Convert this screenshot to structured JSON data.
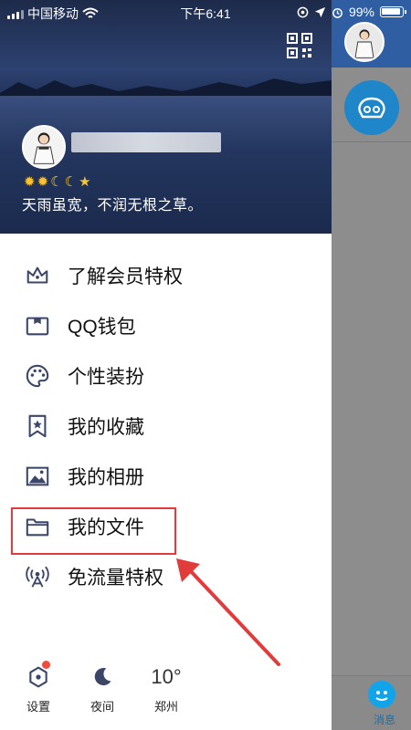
{
  "status_bar": {
    "carrier": "中国移动",
    "time": "下午6:41",
    "battery": "99%"
  },
  "header": {
    "signature": "天雨虽宽，不润无根之草。",
    "level_icons": [
      "sun-icon",
      "sun-icon",
      "moon-icon",
      "moon-icon",
      "star-icon"
    ]
  },
  "menu": [
    {
      "label": "了解会员特权",
      "icon": "crown-icon"
    },
    {
      "label": "QQ钱包",
      "icon": "wallet-icon"
    },
    {
      "label": "个性装扮",
      "icon": "palette-icon"
    },
    {
      "label": "我的收藏",
      "icon": "bookmark-star-icon"
    },
    {
      "label": "我的相册",
      "icon": "album-icon"
    },
    {
      "label": "我的文件",
      "icon": "folder-icon"
    },
    {
      "label": "免流量特权",
      "icon": "broadcast-icon"
    }
  ],
  "bottom": {
    "settings": "设置",
    "night": "夜间",
    "temperature": "10°",
    "city": "郑州"
  },
  "right_pane": {
    "messages_label": "消息"
  },
  "colors": {
    "highlight_border": "#e23b3b",
    "badge_red": "#f04c3c",
    "accent_blue": "#12a4e8"
  }
}
